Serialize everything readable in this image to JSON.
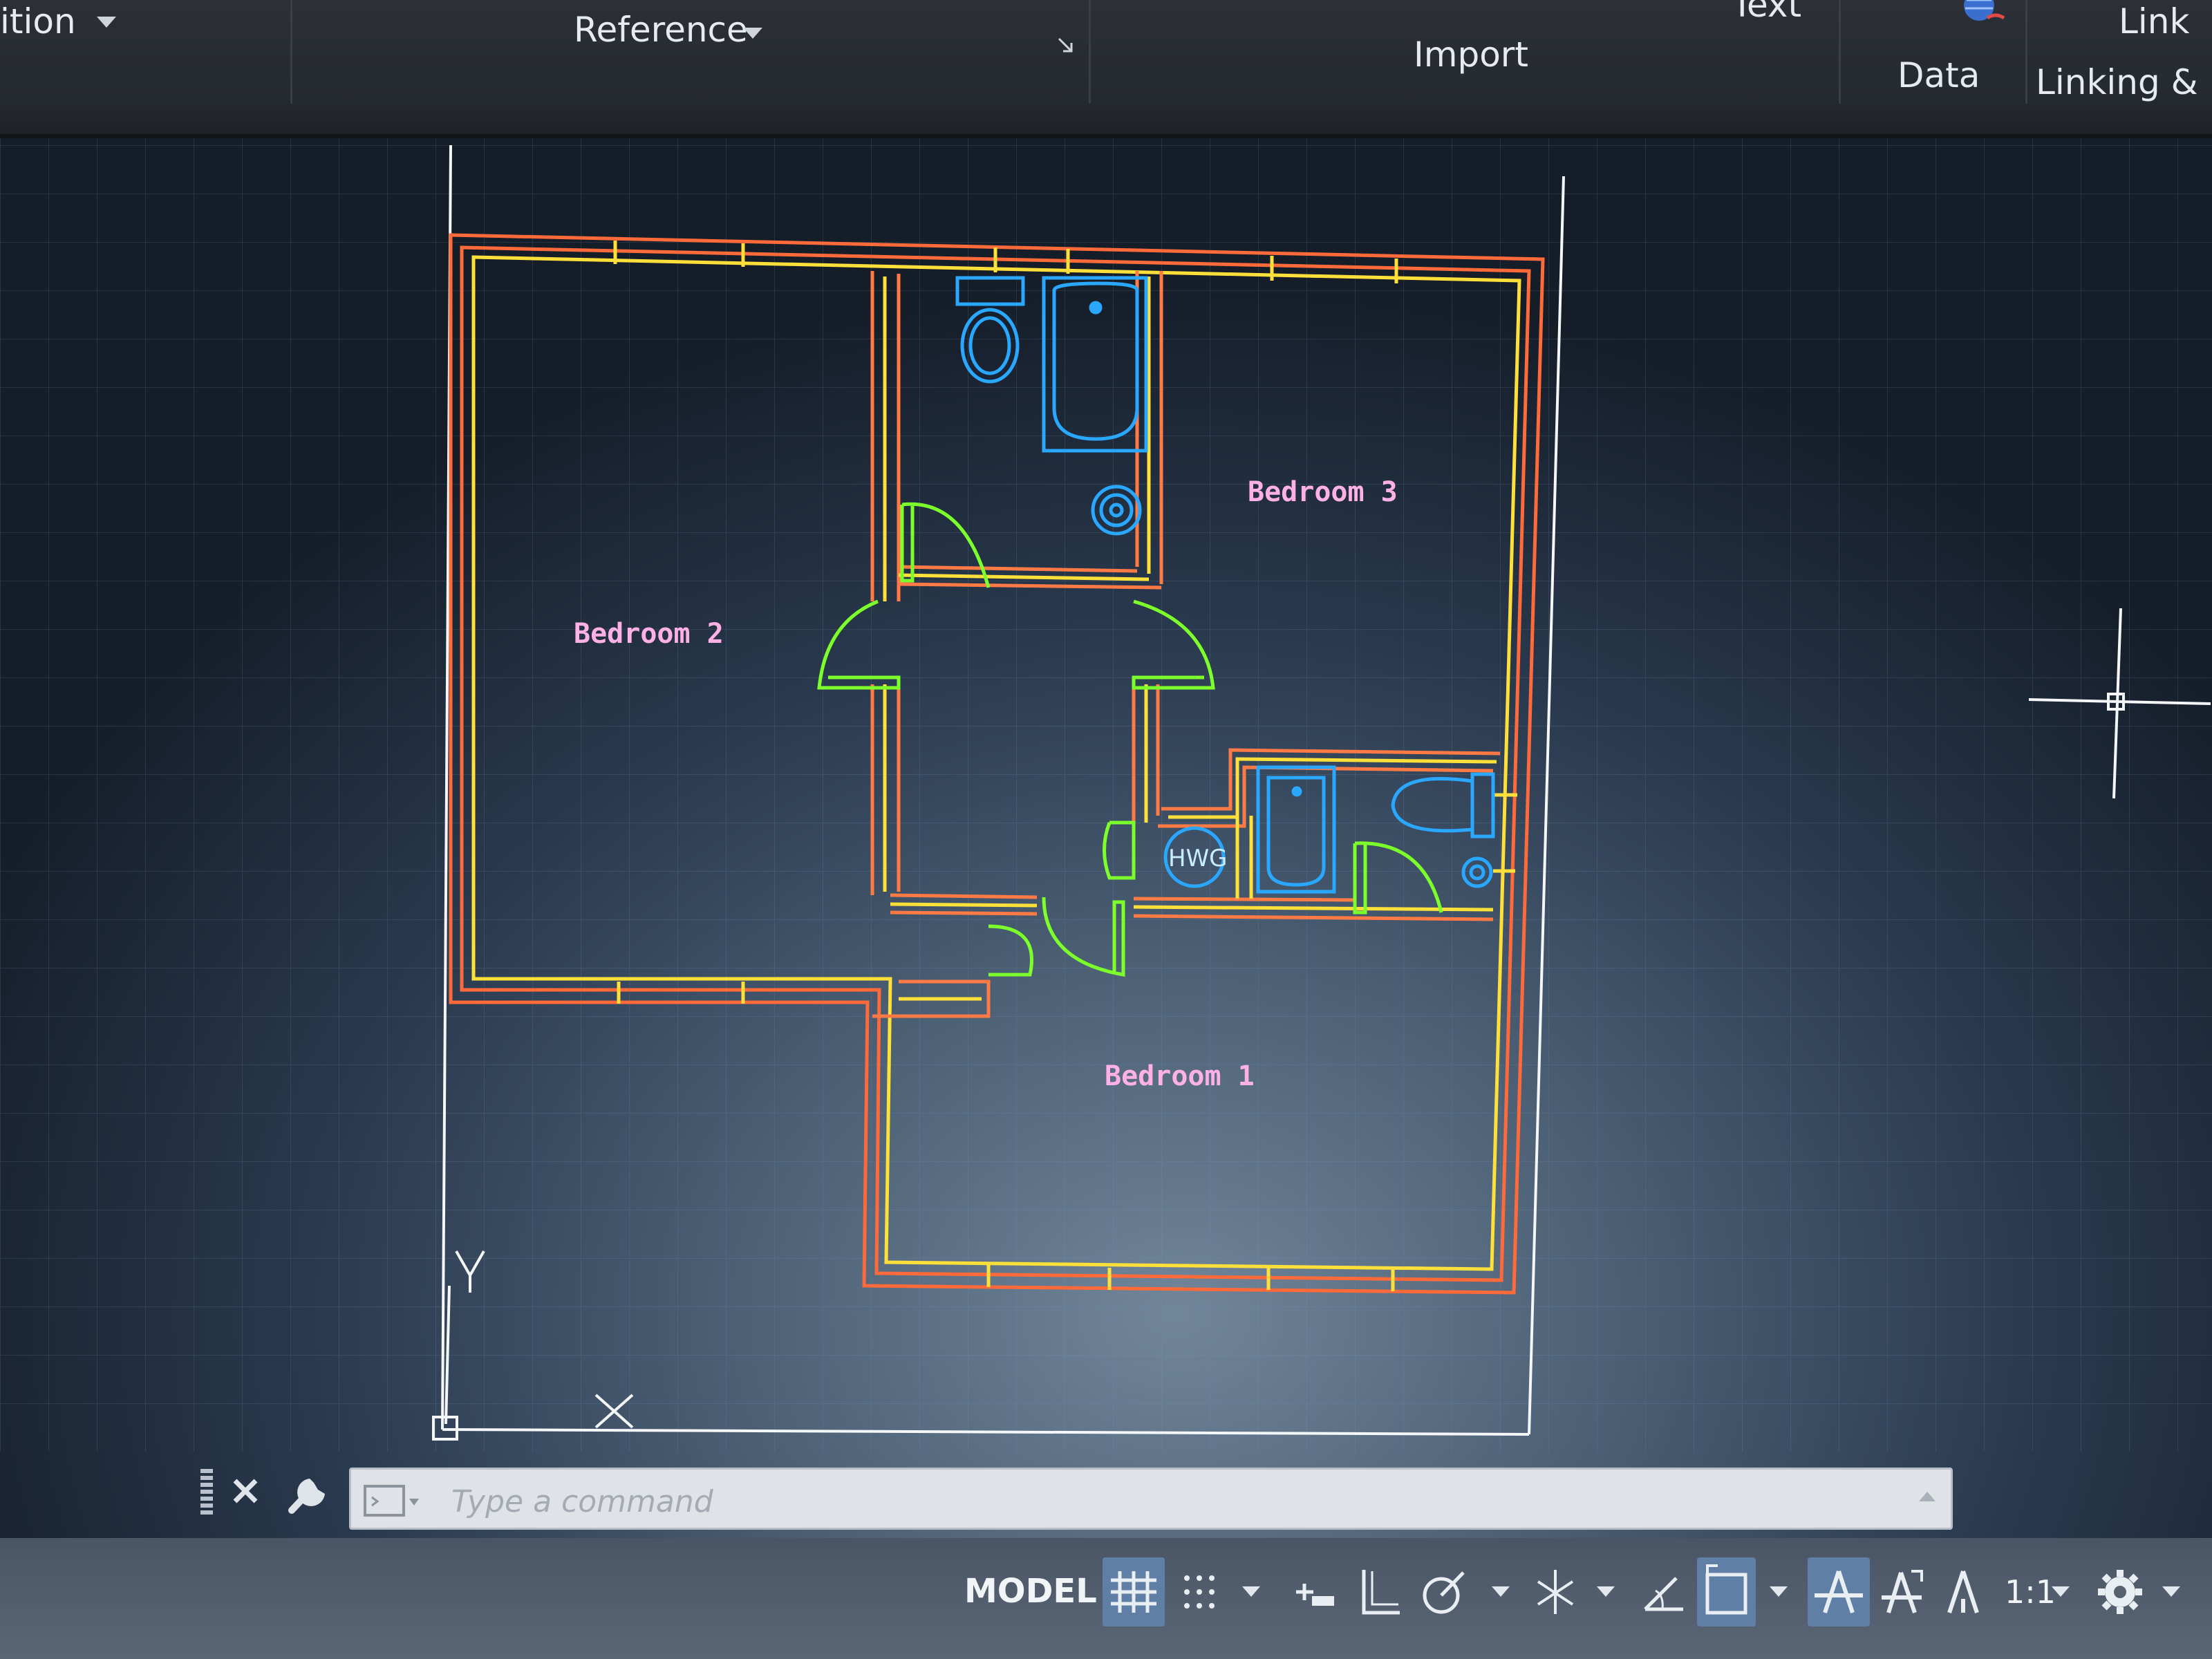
{
  "ribbon": {
    "panels": {
      "definition": "ition",
      "reference": "Reference",
      "import": "Import",
      "text": "Text",
      "data": "Data",
      "link": "Link",
      "linking": "Linking & Ex"
    }
  },
  "drawing": {
    "rooms": {
      "bedroom1": "Bedroom 1",
      "bedroom2": "Bedroom 2",
      "bedroom3": "Bedroom 3",
      "hwg": "HWG"
    },
    "ucs": {
      "x_label": "X",
      "y_label": "Y"
    },
    "colors": {
      "outer_wall": "#ff7a45",
      "inner_wall": "#ffe33a",
      "door": "#7cff2a",
      "fixture": "#2aa7ff",
      "room_text": "#ffb0e6",
      "frame": "#f4f6f8"
    }
  },
  "command_line": {
    "placeholder": "Type a command",
    "value": ""
  },
  "status_bar": {
    "model_tab": "MODEL",
    "scale": "1:1",
    "icons": [
      "grid-icon",
      "snap-icon",
      "infer-icon",
      "ortho-icon",
      "polar-icon",
      "isodraft-icon",
      "osnap-icon",
      "dynamic-ucs-icon",
      "annotation-visibility-icon",
      "autoscale-icon",
      "annotation-scale-icon",
      "workspace-gear-icon"
    ]
  }
}
